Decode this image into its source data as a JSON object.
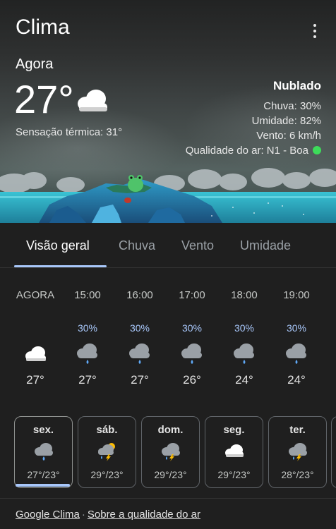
{
  "header": {
    "title": "Clima",
    "menu_icon": "more-vert-icon"
  },
  "current": {
    "label": "Agora",
    "temp": "27°",
    "icon": "cloud-icon",
    "feels_like": "Sensação térmica: 31°",
    "condition": "Nublado",
    "rain": "Chuva: 30%",
    "humidity": "Umidade: 82%",
    "wind": "Vento: 6 km/h",
    "air_quality": "Qualidade do ar: N1 - Boa",
    "air_quality_color": "#3ddc5a"
  },
  "tabs": [
    {
      "label": "Visão geral",
      "active": true
    },
    {
      "label": "Chuva",
      "active": false
    },
    {
      "label": "Vento",
      "active": false
    },
    {
      "label": "Umidade",
      "active": false
    }
  ],
  "hourly": [
    {
      "time": "AGORA",
      "precip": "",
      "icon": "cloud-icon",
      "temp": "27°"
    },
    {
      "time": "15:00",
      "precip": "30%",
      "icon": "cloud-rain-icon",
      "temp": "27°"
    },
    {
      "time": "16:00",
      "precip": "30%",
      "icon": "cloud-rain-icon",
      "temp": "27°"
    },
    {
      "time": "17:00",
      "precip": "30%",
      "icon": "cloud-rain-icon",
      "temp": "26°"
    },
    {
      "time": "18:00",
      "precip": "30%",
      "icon": "cloud-rain-icon",
      "temp": "24°"
    },
    {
      "time": "19:00",
      "precip": "30%",
      "icon": "cloud-rain-icon",
      "temp": "24°"
    }
  ],
  "daily": [
    {
      "day": "sex.",
      "icon": "cloud-rain-icon",
      "temps": "27°/23°",
      "selected": true
    },
    {
      "day": "sáb.",
      "icon": "thunderstorm-sun-icon",
      "temps": "29°/23°",
      "selected": false
    },
    {
      "day": "dom.",
      "icon": "thunderstorm-icon",
      "temps": "29°/23°",
      "selected": false
    },
    {
      "day": "seg.",
      "icon": "cloud-icon",
      "temps": "29°/23°",
      "selected": false
    },
    {
      "day": "ter.",
      "icon": "thunderstorm-icon",
      "temps": "28°/23°",
      "selected": false
    }
  ],
  "footer": {
    "link1": "Google Clima",
    "separator": "·",
    "link2": "Sobre a qualidade do ar"
  },
  "colors": {
    "accent": "#a8c7fa",
    "background": "#1f1f1f"
  }
}
